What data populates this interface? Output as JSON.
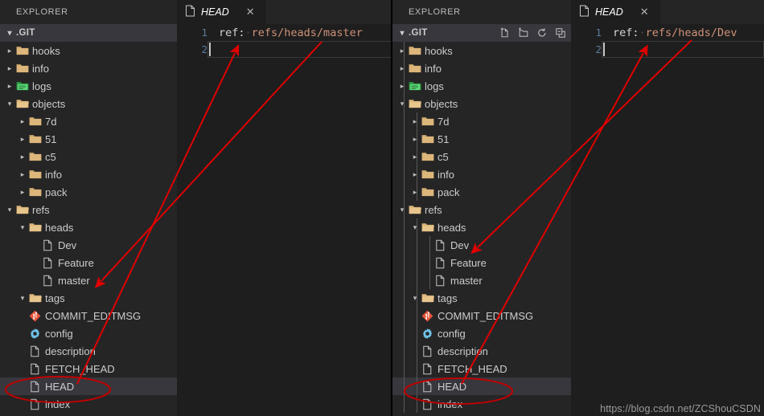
{
  "left_pane": {
    "explorer_title": "EXPLORER",
    "root_label": ".GIT",
    "tree": [
      {
        "label": "hooks",
        "icon": "folder-icon",
        "twisty": "collapsed",
        "depth": 1
      },
      {
        "label": "info",
        "icon": "folder-icon",
        "twisty": "collapsed",
        "depth": 1
      },
      {
        "label": "logs",
        "icon": "folder-green-icon",
        "twisty": "collapsed",
        "depth": 1
      },
      {
        "label": "objects",
        "icon": "folder-open-icon",
        "twisty": "expanded",
        "depth": 1
      },
      {
        "label": "7d",
        "icon": "folder-icon",
        "twisty": "collapsed",
        "depth": 2
      },
      {
        "label": "51",
        "icon": "folder-icon",
        "twisty": "collapsed",
        "depth": 2
      },
      {
        "label": "c5",
        "icon": "folder-icon",
        "twisty": "collapsed",
        "depth": 2
      },
      {
        "label": "info",
        "icon": "folder-icon",
        "twisty": "collapsed",
        "depth": 2
      },
      {
        "label": "pack",
        "icon": "folder-icon",
        "twisty": "collapsed",
        "depth": 2
      },
      {
        "label": "refs",
        "icon": "folder-open-icon",
        "twisty": "expanded",
        "depth": 1
      },
      {
        "label": "heads",
        "icon": "folder-open-icon",
        "twisty": "expanded",
        "depth": 2
      },
      {
        "label": "Dev",
        "icon": "file-icon",
        "twisty": "none",
        "depth": 3
      },
      {
        "label": "Feature",
        "icon": "file-icon",
        "twisty": "none",
        "depth": 3
      },
      {
        "label": "master",
        "icon": "file-icon",
        "twisty": "none",
        "depth": 3
      },
      {
        "label": "tags",
        "icon": "folder-open-icon",
        "twisty": "expanded",
        "depth": 2
      },
      {
        "label": "COMMIT_EDITMSG",
        "icon": "git-icon",
        "twisty": "none",
        "depth": 2
      },
      {
        "label": "config",
        "icon": "gear-icon",
        "twisty": "none",
        "depth": 2
      },
      {
        "label": "description",
        "icon": "file-icon",
        "twisty": "none",
        "depth": 2
      },
      {
        "label": "FETCH_HEAD",
        "icon": "file-icon",
        "twisty": "none",
        "depth": 2
      },
      {
        "label": "HEAD",
        "icon": "file-icon",
        "twisty": "none",
        "depth": 2,
        "selected": true
      },
      {
        "label": "index",
        "icon": "file-icon",
        "twisty": "none",
        "depth": 2
      }
    ],
    "editor": {
      "tab_label": "HEAD",
      "tab_icon": "file-icon",
      "close_icon": "close-icon",
      "lines": [
        {
          "number": "1",
          "prefix": "ref:",
          "sep": "·",
          "value": "refs/heads/master"
        },
        {
          "number": "2",
          "prefix": "",
          "sep": "",
          "value": ""
        }
      ]
    }
  },
  "right_pane": {
    "explorer_title": "EXPLORER",
    "root_label": ".GIT",
    "header_actions": [
      "new-file-icon",
      "new-folder-icon",
      "refresh-icon",
      "collapse-all-icon"
    ],
    "tree": [
      {
        "label": "hooks",
        "icon": "folder-icon",
        "twisty": "collapsed",
        "depth": 1
      },
      {
        "label": "info",
        "icon": "folder-icon",
        "twisty": "collapsed",
        "depth": 1
      },
      {
        "label": "logs",
        "icon": "folder-green-icon",
        "twisty": "collapsed",
        "depth": 1
      },
      {
        "label": "objects",
        "icon": "folder-open-icon",
        "twisty": "expanded",
        "depth": 1
      },
      {
        "label": "7d",
        "icon": "folder-icon",
        "twisty": "collapsed",
        "depth": 2
      },
      {
        "label": "51",
        "icon": "folder-icon",
        "twisty": "collapsed",
        "depth": 2
      },
      {
        "label": "c5",
        "icon": "folder-icon",
        "twisty": "collapsed",
        "depth": 2
      },
      {
        "label": "info",
        "icon": "folder-icon",
        "twisty": "collapsed",
        "depth": 2
      },
      {
        "label": "pack",
        "icon": "folder-icon",
        "twisty": "collapsed",
        "depth": 2
      },
      {
        "label": "refs",
        "icon": "folder-open-icon",
        "twisty": "expanded",
        "depth": 1
      },
      {
        "label": "heads",
        "icon": "folder-open-icon",
        "twisty": "expanded",
        "depth": 2
      },
      {
        "label": "Dev",
        "icon": "file-icon",
        "twisty": "none",
        "depth": 3
      },
      {
        "label": "Feature",
        "icon": "file-icon",
        "twisty": "none",
        "depth": 3
      },
      {
        "label": "master",
        "icon": "file-icon",
        "twisty": "none",
        "depth": 3
      },
      {
        "label": "tags",
        "icon": "folder-open-icon",
        "twisty": "expanded",
        "depth": 2
      },
      {
        "label": "COMMIT_EDITMSG",
        "icon": "git-icon",
        "twisty": "none",
        "depth": 2
      },
      {
        "label": "config",
        "icon": "gear-icon",
        "twisty": "none",
        "depth": 2
      },
      {
        "label": "description",
        "icon": "file-icon",
        "twisty": "none",
        "depth": 2
      },
      {
        "label": "FETCH_HEAD",
        "icon": "file-icon",
        "twisty": "none",
        "depth": 2
      },
      {
        "label": "HEAD",
        "icon": "file-icon",
        "twisty": "none",
        "depth": 2,
        "selected": true
      },
      {
        "label": "index",
        "icon": "file-icon",
        "twisty": "none",
        "depth": 2
      }
    ],
    "editor": {
      "tab_label": "HEAD",
      "tab_icon": "file-icon",
      "close_icon": "close-icon",
      "lines": [
        {
          "number": "1",
          "prefix": "ref:",
          "sep": "·",
          "value": "refs/heads/Dev"
        },
        {
          "number": "2",
          "prefix": "",
          "sep": "",
          "value": ""
        }
      ]
    }
  },
  "annotations": {
    "color": "#e00000",
    "highlight_ellipses": [
      {
        "target": "left HEAD file entry"
      },
      {
        "target": "right HEAD file entry"
      }
    ],
    "arrows": [
      {
        "from": "left HEAD entry",
        "to": "left editor line 2 caret"
      },
      {
        "from": "left HEAD entry",
        "to": "left tree master file"
      },
      {
        "from": "right HEAD entry",
        "to": "right editor line 2 caret"
      },
      {
        "from": "right HEAD entry",
        "to": "right tree Dev file"
      }
    ]
  },
  "watermark": {
    "text": "https://blog.csdn.net/ZCShouCSDN"
  },
  "colors": {
    "sidebar_bg": "#252526",
    "editor_bg": "#1e1e1e",
    "selected_row": "#37373d",
    "folder": "#dcb67a",
    "folder_green": "#4caf50",
    "git_red": "#e8553a",
    "gear_blue": "#6ec2e8",
    "string_orange": "#ce9178",
    "linenumber": "#5a7ca0",
    "annotation_red": "#e00000"
  }
}
